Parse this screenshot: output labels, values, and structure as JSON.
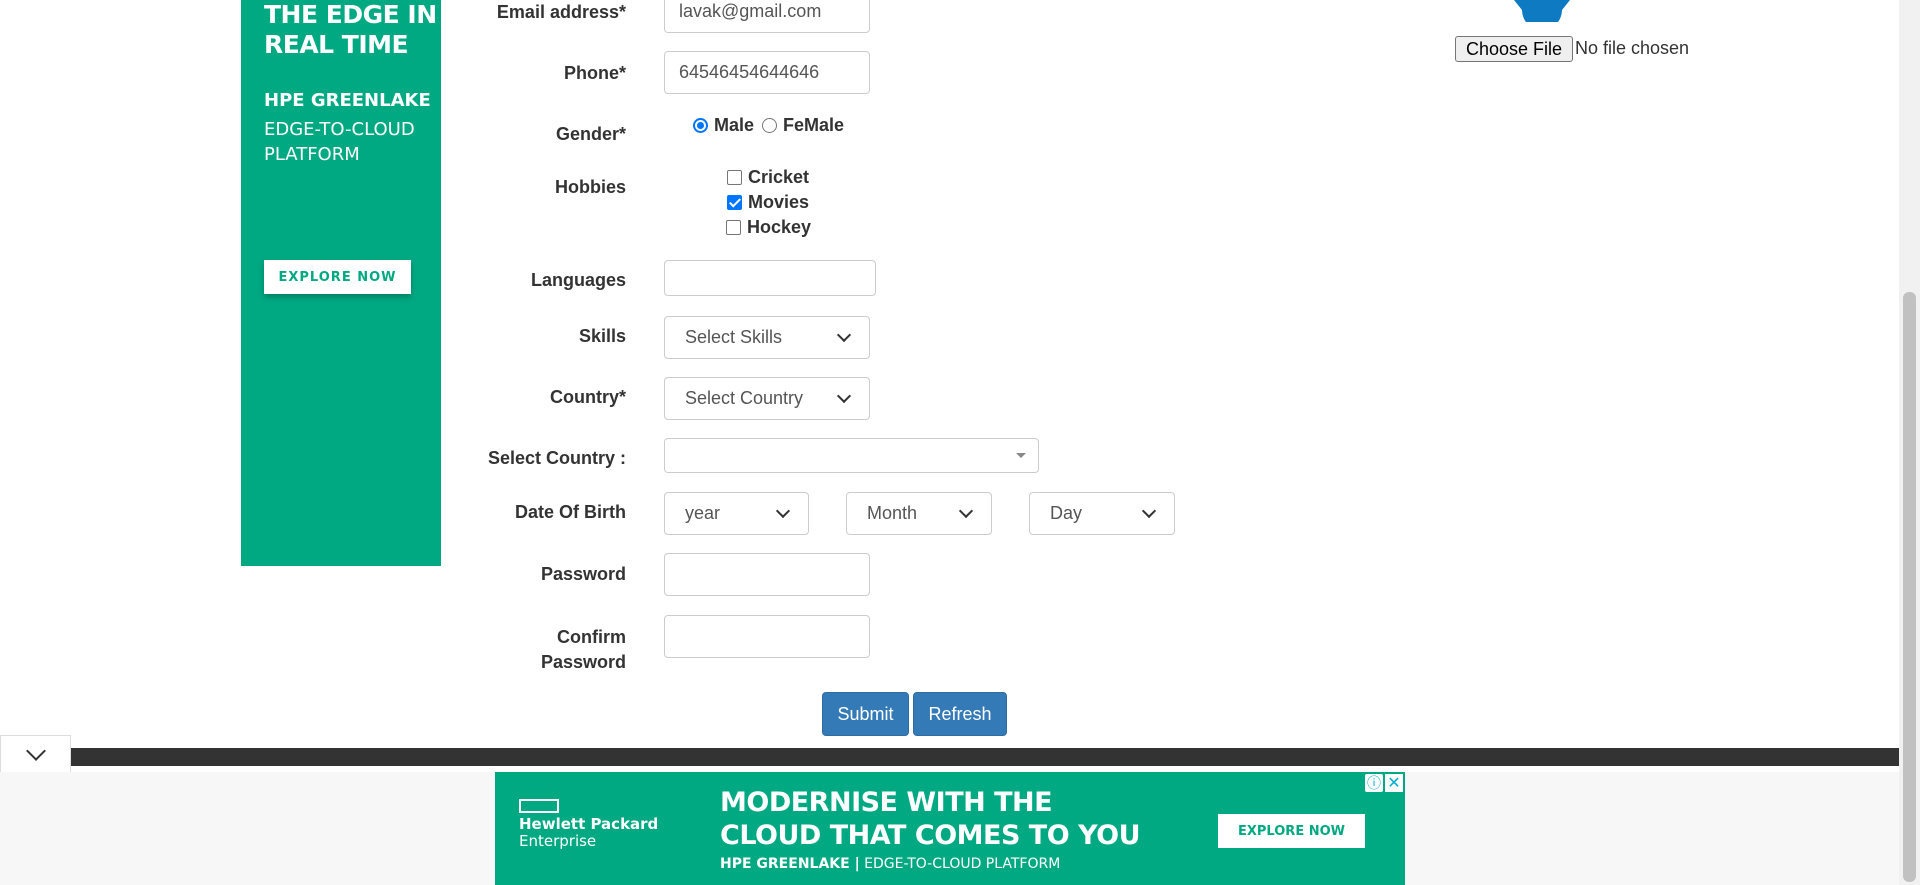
{
  "side_ad": {
    "headline_line1": "THE EDGE IN",
    "headline_line2": "REAL TIME",
    "brand": "HPE GREENLAKE",
    "platform_line1": "EDGE-TO-CLOUD",
    "platform_line2": "PLATFORM",
    "cta": "EXPLORE NOW"
  },
  "form": {
    "email": {
      "label": "Email address*",
      "value": "lavak@gmail.com"
    },
    "phone": {
      "label": "Phone*",
      "value": "64546454644646"
    },
    "gender": {
      "label": "Gender*",
      "options": [
        "Male",
        "FeMale"
      ],
      "selected": "Male"
    },
    "hobbies": {
      "label": "Hobbies",
      "options": [
        {
          "label": "Cricket",
          "checked": false
        },
        {
          "label": "Movies",
          "checked": true
        },
        {
          "label": "Hockey",
          "checked": false
        }
      ]
    },
    "languages": {
      "label": "Languages",
      "value": ""
    },
    "skills": {
      "label": "Skills",
      "selected": "Select Skills"
    },
    "country": {
      "label": "Country*",
      "selected": "Select Country"
    },
    "select_country": {
      "label": "Select Country :",
      "selected": ""
    },
    "dob": {
      "label": "Date Of Birth",
      "year": "year",
      "month": "Month",
      "day": "Day"
    },
    "password": {
      "label": "Password",
      "value": ""
    },
    "confirm_password": {
      "label_line1": "Confirm",
      "label_line2": "Password",
      "value": ""
    },
    "submit_label": "Submit",
    "refresh_label": "Refresh"
  },
  "file_upload": {
    "button": "Choose File",
    "status": "No file chosen"
  },
  "bottom_ad": {
    "logo_line1": "Hewlett Packard",
    "logo_line2": "Enterprise",
    "headline_line1": "MODERNISE WITH THE",
    "headline_line2": "CLOUD THAT COMES TO YOU",
    "tagline_brand": "HPE GREENLAKE |",
    "tagline_rest": " EDGE-TO-CLOUD PLATFORM",
    "cta": "EXPLORE NOW",
    "adchoices": "ⓘ",
    "close": "✕"
  },
  "colors": {
    "ad_green": "#01a982",
    "button_blue": "#337ab7",
    "footer_dark": "#333333"
  }
}
